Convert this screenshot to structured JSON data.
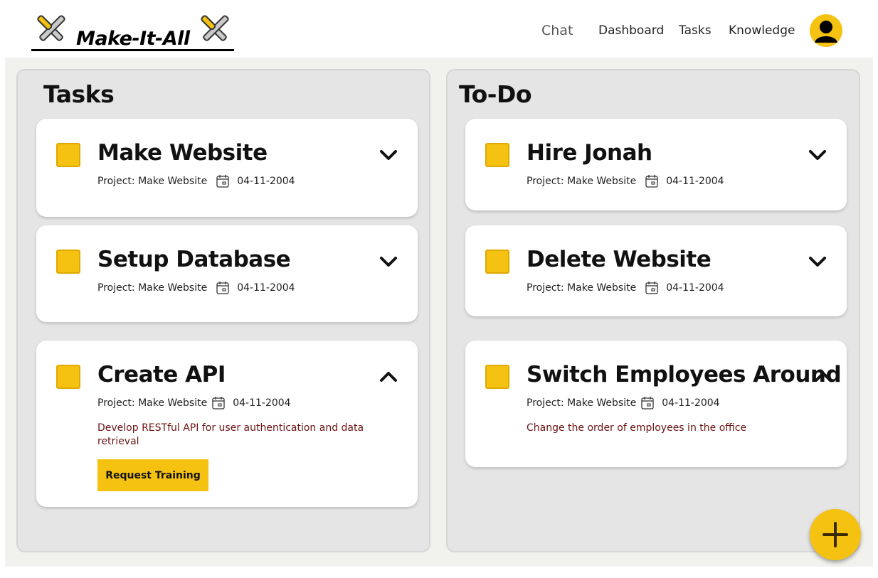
{
  "app": {
    "logo_text": "Make-It-All"
  },
  "nav": {
    "chat": "Chat",
    "dashboard": "Dashboard",
    "tasks": "Tasks",
    "knowledge": "Knowledge"
  },
  "colors": {
    "accent": "#f5c211",
    "description_text": "#6b1414",
    "column_bg": "#e5e5e5"
  },
  "columns": [
    {
      "title": "Tasks",
      "cards": [
        {
          "title": "Make Website",
          "project": "Project: Make Website",
          "date": "04-11-2004",
          "expanded": false
        },
        {
          "title": "Setup Database",
          "project": "Project: Make Website",
          "date": "04-11-2004",
          "expanded": false
        },
        {
          "title": "Create API",
          "project": "Project: Make Website",
          "date": "04-11-2004",
          "expanded": true,
          "description": "Develop RESTful API for user authentication and data retrieval",
          "button_label": "Request Training"
        }
      ]
    },
    {
      "title": "To-Do",
      "cards": [
        {
          "title": "Hire Jonah",
          "project": "Project: Make Website",
          "date": "04-11-2004",
          "expanded": false
        },
        {
          "title": "Delete Website",
          "project": "Project: Make Website",
          "date": "04-11-2004",
          "expanded": false
        },
        {
          "title": "Switch Employees Around",
          "project": "Project: Make Website",
          "date": "04-11-2004",
          "expanded": true,
          "description": "Change the order of employees in the office"
        }
      ]
    }
  ],
  "icons": {
    "logo": "wrench-cross-icon",
    "avatar": "user-avatar-icon",
    "checkbox": "checkbox-icon",
    "collapse": "chevron-down-icon",
    "expand": "chevron-up-icon",
    "date": "calendar-icon",
    "add": "plus-icon"
  }
}
